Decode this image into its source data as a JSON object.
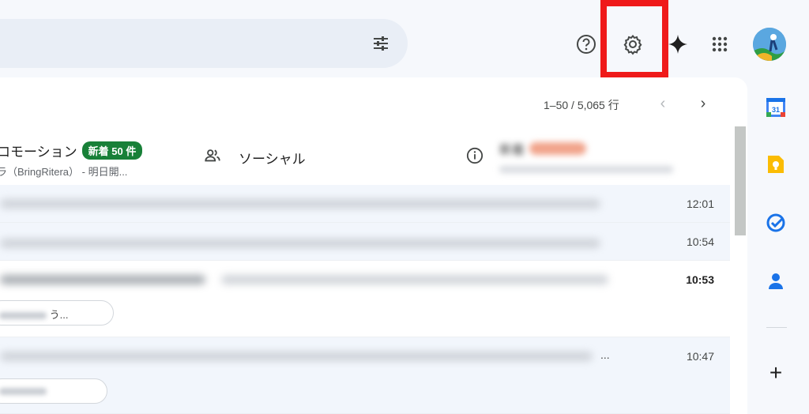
{
  "topbar": {
    "icons": [
      "tune-icon",
      "help-icon",
      "settings-icon",
      "gemini-sparkle-icon",
      "apps-grid-icon",
      "account-avatar"
    ]
  },
  "pager": {
    "range": "1–50 / 5,065 行"
  },
  "tabs": {
    "promotions": {
      "label": "ロモーション",
      "badge": "新着 50 件",
      "preview": "ラ（BringRitera） - 明日開..."
    },
    "social": {
      "label": "ソーシャル"
    },
    "updates": {
      "label": "新着"
    }
  },
  "rows": [
    {
      "time": "12:01",
      "read": true
    },
    {
      "time": "10:54",
      "read": true
    },
    {
      "time": "10:53",
      "read": false,
      "chip": "う..."
    },
    {
      "time": "10:47",
      "read": true,
      "ellipsis": "..."
    }
  ],
  "side_panel": {
    "calendar_day": "31",
    "icons": [
      "calendar-icon",
      "keep-icon",
      "tasks-icon",
      "contacts-icon",
      "add-icon"
    ],
    "add_label": "+"
  },
  "colors": {
    "highlight": "#ef1a1a",
    "badge": "#188038",
    "background": "#f6f8fc"
  }
}
